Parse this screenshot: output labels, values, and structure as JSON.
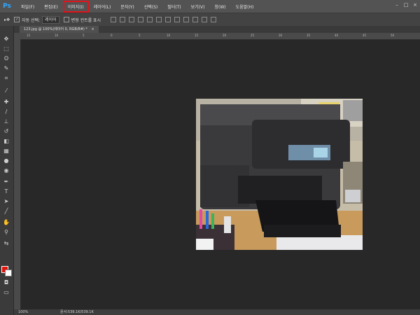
{
  "menu": {
    "app_logo": "Ps",
    "items": [
      "파일(F)",
      "편집(E)",
      "이미지(I)",
      "레이어(L)",
      "문자(Y)",
      "선택(S)",
      "필터(T)",
      "보기(V)",
      "창(W)",
      "도움말(H)"
    ],
    "highlighted_item": "이미지(I)"
  },
  "options": {
    "auto_select_label": "자동 선택:",
    "auto_select_value": "레이어",
    "show_transform_label": "변형 컨트롤 표시"
  },
  "document": {
    "tab_title": "123.jpg @ 100%(레이어 0, RGB/8#) *",
    "close_glyph": "×"
  },
  "ruler": {
    "ticks": [
      "15",
      "10",
      "5",
      "0",
      "5",
      "10",
      "15",
      "20",
      "25",
      "30",
      "35",
      "40",
      "45",
      "50"
    ]
  },
  "status": {
    "zoom": "100%",
    "doc_info": "문서:539.1K/539.1K"
  },
  "colors": {
    "foreground": "#e3120b",
    "background": "#ffffff",
    "highlight_box": "#e0141b"
  }
}
